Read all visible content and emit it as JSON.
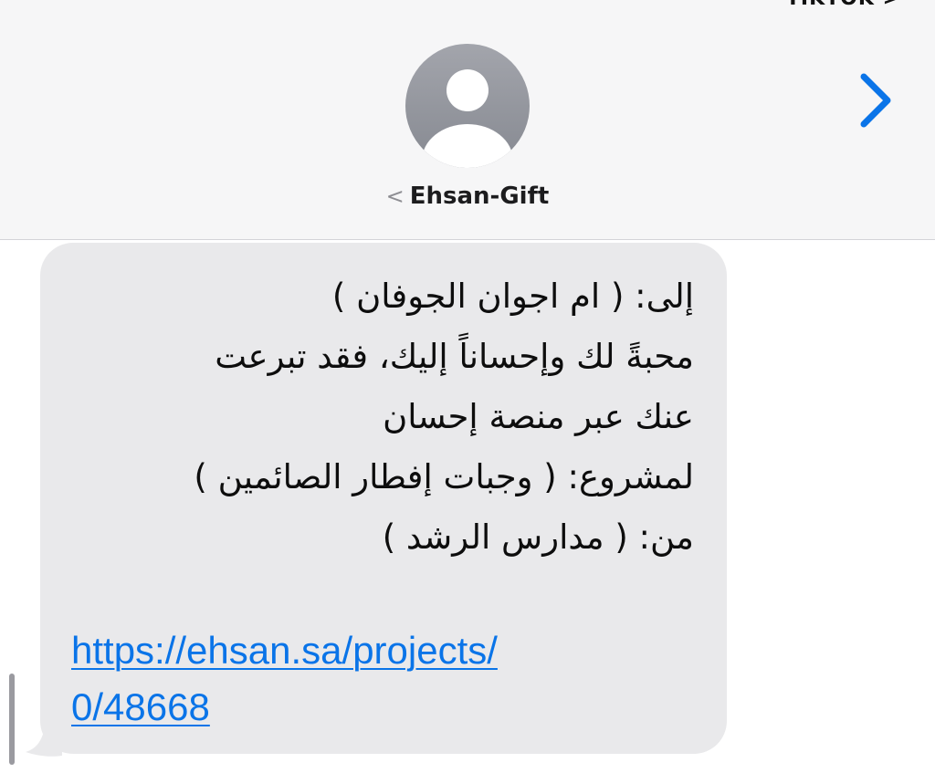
{
  "status_fragment": "TIKTOK >",
  "header": {
    "contact_name": "Ehsan-Gift",
    "back_chevron": "<",
    "avatar_icon": "person-silhouette",
    "info_icon": "chevron-right-icon",
    "accent_color": "#0a74e8"
  },
  "message": {
    "lines": [
      "إلى: ( ام اجوان الجوفان )",
      "محبةً لك وإحساناً إليك، فقد تبرعت",
      "عنك عبر منصة إحسان",
      "لمشروع: ( وجبات إفطار الصائمين )",
      "من: ( مدارس الرشد )"
    ],
    "link_lines": [
      "https://ehsan.sa/projects/",
      "0/48668"
    ],
    "bubble_color": "#e9e9eb"
  }
}
